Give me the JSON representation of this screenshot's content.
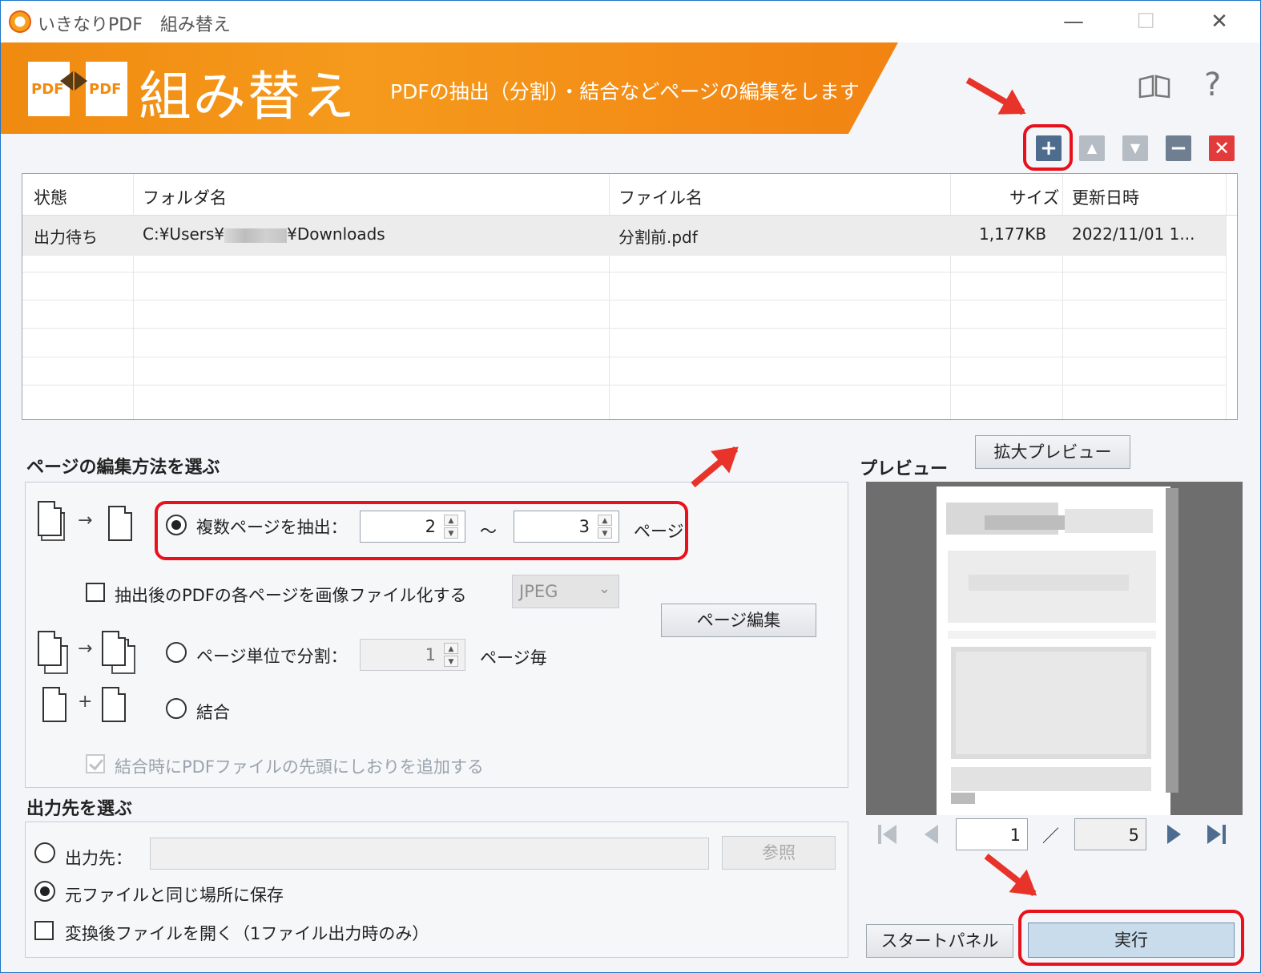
{
  "window": {
    "title": "いきなりPDF　組み替え",
    "minimize": "—",
    "maximize": "☐",
    "close": "✕"
  },
  "banner": {
    "logo_text_left": "PDF",
    "logo_text_right": "PDF",
    "title": "組み替え",
    "subtitle": "PDFの抽出（分割）・結合などページの編集をします",
    "help": "?"
  },
  "toolbar": {
    "add": "+",
    "up": "▲",
    "down": "▼",
    "remove": "−",
    "clear": "✕"
  },
  "file_list": {
    "columns": [
      "状態",
      "フォルダ名",
      "ファイル名",
      "サイズ",
      "更新日時"
    ],
    "rows": [
      {
        "status": "出力待ち",
        "folder_prefix": "C:¥Users¥",
        "folder_suffix": "¥Downloads",
        "file": "分割前.pdf",
        "size": "1,177KB",
        "modified": "2022/11/01 1..."
      }
    ]
  },
  "edit_method": {
    "title": "ページの編集方法を選ぶ",
    "extract_label": "複数ページを抽出：",
    "extract_from": "2",
    "tilde": "～",
    "extract_to": "3",
    "page_unit": "ページ",
    "to_image_label": "抽出後のPDFの各ページを画像ファイル化する",
    "image_format": "JPEG",
    "page_edit_button": "ページ編集",
    "split_label": "ページ単位で分割：",
    "split_value": "1",
    "split_unit": "ページ毎",
    "merge_label": "結合",
    "bookmark_label": "結合時にPDFファイルの先頭にしおりを追加する"
  },
  "output": {
    "title": "出力先を選ぶ",
    "dest_label": "出力先：",
    "browse_button": "参照",
    "same_place_label": "元ファイルと同じ場所に保存",
    "open_after_label": "変換後ファイルを開く（1ファイル出力時のみ）"
  },
  "preview": {
    "title": "プレビュー",
    "zoom_button": "拡大プレビュー",
    "current_page": "1",
    "separator": "／",
    "total_pages": "5"
  },
  "footer": {
    "start_panel": "スタートパネル",
    "run": "実行"
  },
  "colors": {
    "banner_orange": "#f08a10",
    "highlight_red": "#e8111b",
    "add_button": "#4e6d8e",
    "clear_button": "#e23b3b",
    "run_button": "#c9dcec"
  }
}
